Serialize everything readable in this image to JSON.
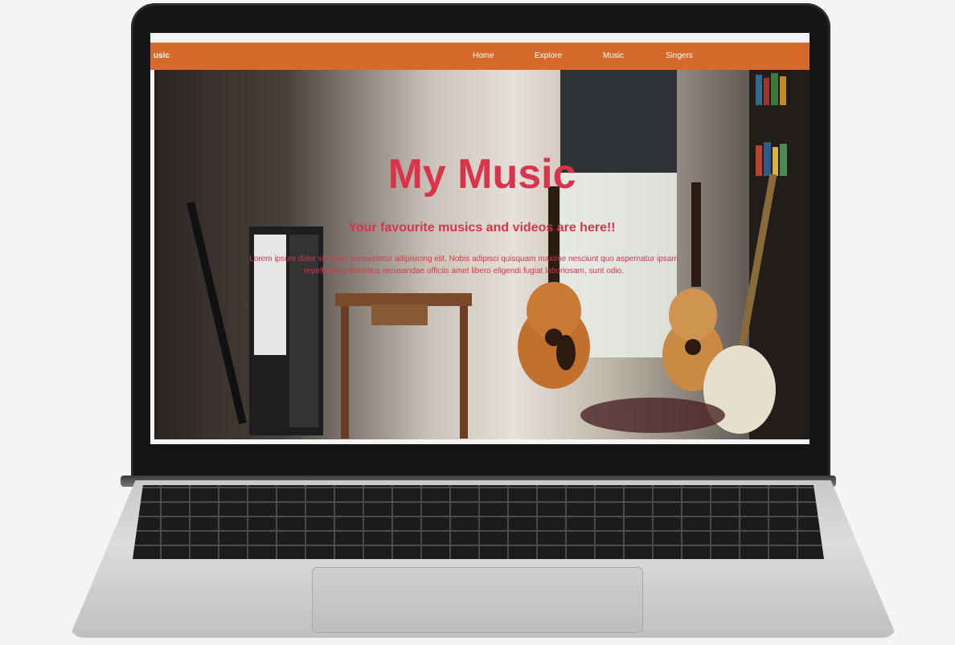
{
  "nav": {
    "brand": "usic",
    "items": [
      {
        "label": "Home"
      },
      {
        "label": "Explore"
      },
      {
        "label": "Music"
      },
      {
        "label": "Singers"
      }
    ]
  },
  "hero": {
    "title": "My Music",
    "subtitle": "Your favourite musics and videos are here!!",
    "body": "Lorem ipsum dolor sit amet, consectetur adipisicing elit. Nobis adipisci quisquam maxime nesciunt quo aspernatur ipsam repellendus doloribus recusandae officiis amet libero eligendi fugiat laboriosam, sunt odio."
  },
  "colors": {
    "navbar": "#d66a2c",
    "accent_text": "#d8344a"
  }
}
